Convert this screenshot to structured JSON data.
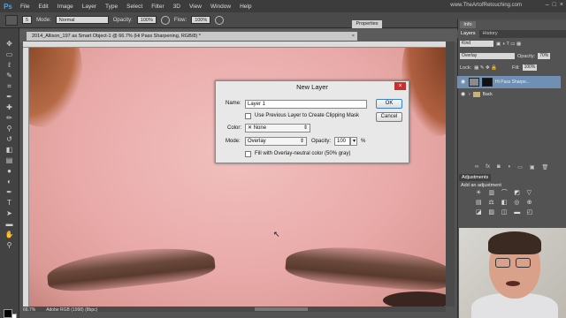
{
  "app": {
    "logo": "Ps",
    "site_url": "www.TheArtofRetouching.com"
  },
  "menu": [
    "File",
    "Edit",
    "Image",
    "Layer",
    "Type",
    "Select",
    "Filter",
    "3D",
    "View",
    "Window",
    "Help"
  ],
  "options_bar": {
    "brush_size": "5",
    "mode_label": "Mode:",
    "mode_value": "Normal",
    "opacity_label": "Opacity:",
    "opacity_value": "100%",
    "flow_label": "Flow:",
    "flow_value": "100%"
  },
  "document": {
    "tab_title": "2014_Allison_197 as Smart Object-1 @ 66.7% (Hi Pass Sharpening, RGB/8) *",
    "close_glyph": "×",
    "zoom": "66.7%",
    "profile": "Adobe RGB (1998) (8bpc)"
  },
  "properties_tab": "Properties",
  "dialog": {
    "title": "New Layer",
    "close_glyph": "×",
    "name_label": "Name:",
    "name_value": "Layer 1",
    "clipping_label": "Use Previous Layer to Create Clipping Mask",
    "color_label": "Color:",
    "color_value": "None",
    "mode_label": "Mode:",
    "mode_value": "Overlay",
    "opacity_label": "Opacity:",
    "opacity_value": "100",
    "opacity_unit": "%",
    "fill_label": "Fill with Overlay-neutral color (50% gray)",
    "ok_label": "OK",
    "cancel_label": "Cancel"
  },
  "right_panel": {
    "info_tab": "Info",
    "tabs": [
      "Layers",
      "History"
    ],
    "kind_value": "Kind",
    "blend_value": "Overlay",
    "opacity_label": "Opacity:",
    "opacity_value": "70%",
    "lock_label": "Lock:",
    "fill_label": "Fill:",
    "fill_value": "100%",
    "layers": [
      {
        "name": "Hi Pass Sharpe...",
        "selected": true
      },
      {
        "name": "Back",
        "selected": false
      }
    ],
    "adjustments_tab": "Adjustments",
    "adjustments_title": "Add an adjustment"
  },
  "icons": {
    "eye": "eye-icon",
    "folder": "folder-icon",
    "brush": "brush-icon",
    "move": "move-icon"
  }
}
